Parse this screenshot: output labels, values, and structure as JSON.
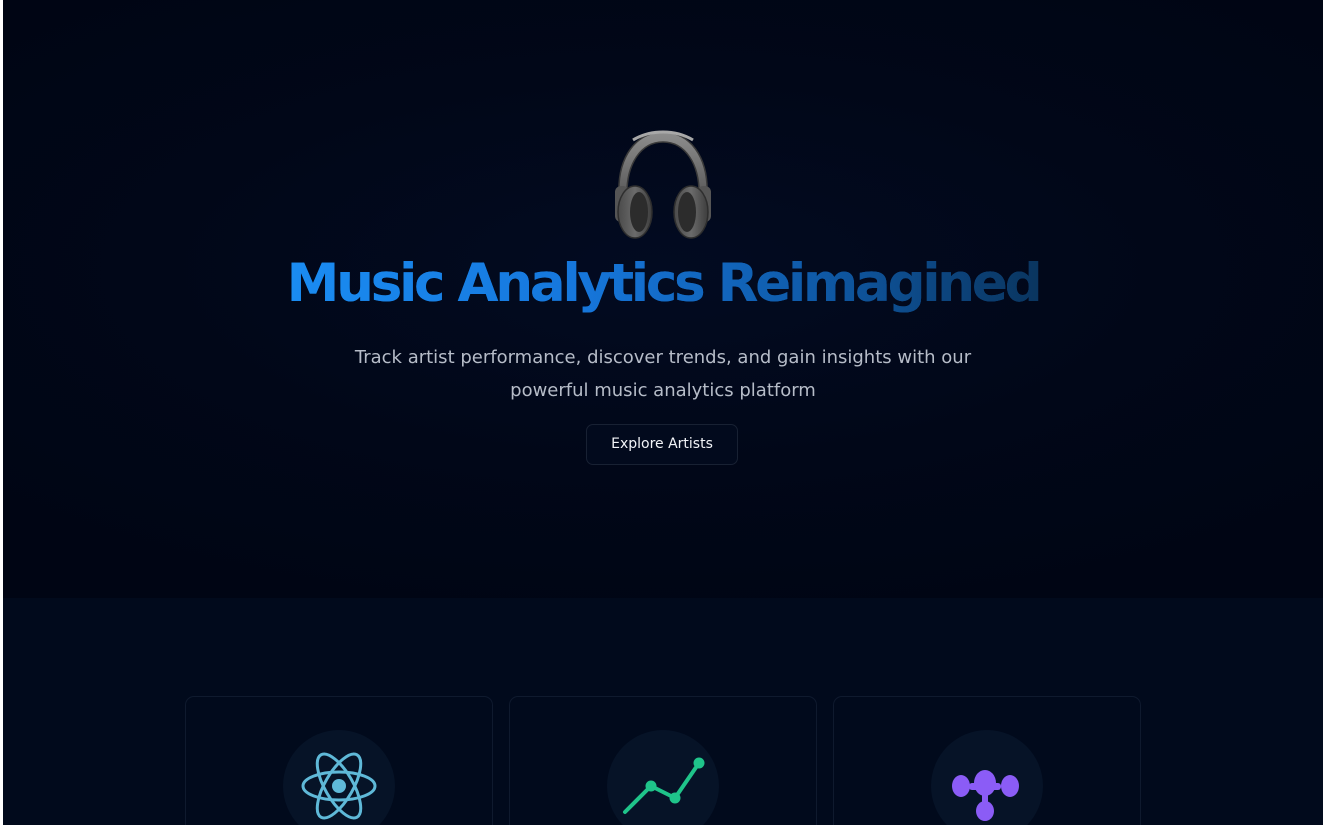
{
  "hero": {
    "icon": "headphones-icon",
    "title": "Music Analytics Reimagined",
    "subtitle_line1": "Track artist performance, discover trends, and gain insights with our",
    "subtitle_line2": "powerful music analytics platform",
    "cta_label": "Explore Artists",
    "title_gradient": [
      "#1a8cf2",
      "#0a355f"
    ],
    "background": "#000514"
  },
  "features": {
    "cards": [
      {
        "icon": "atom-icon",
        "icon_color": "#5fb9d8"
      },
      {
        "icon": "trending-chart-icon",
        "icon_color": "#1fc48a"
      },
      {
        "icon": "molecule-icon",
        "icon_color": "#8b5cf6"
      }
    ],
    "background": "#010a1c"
  }
}
